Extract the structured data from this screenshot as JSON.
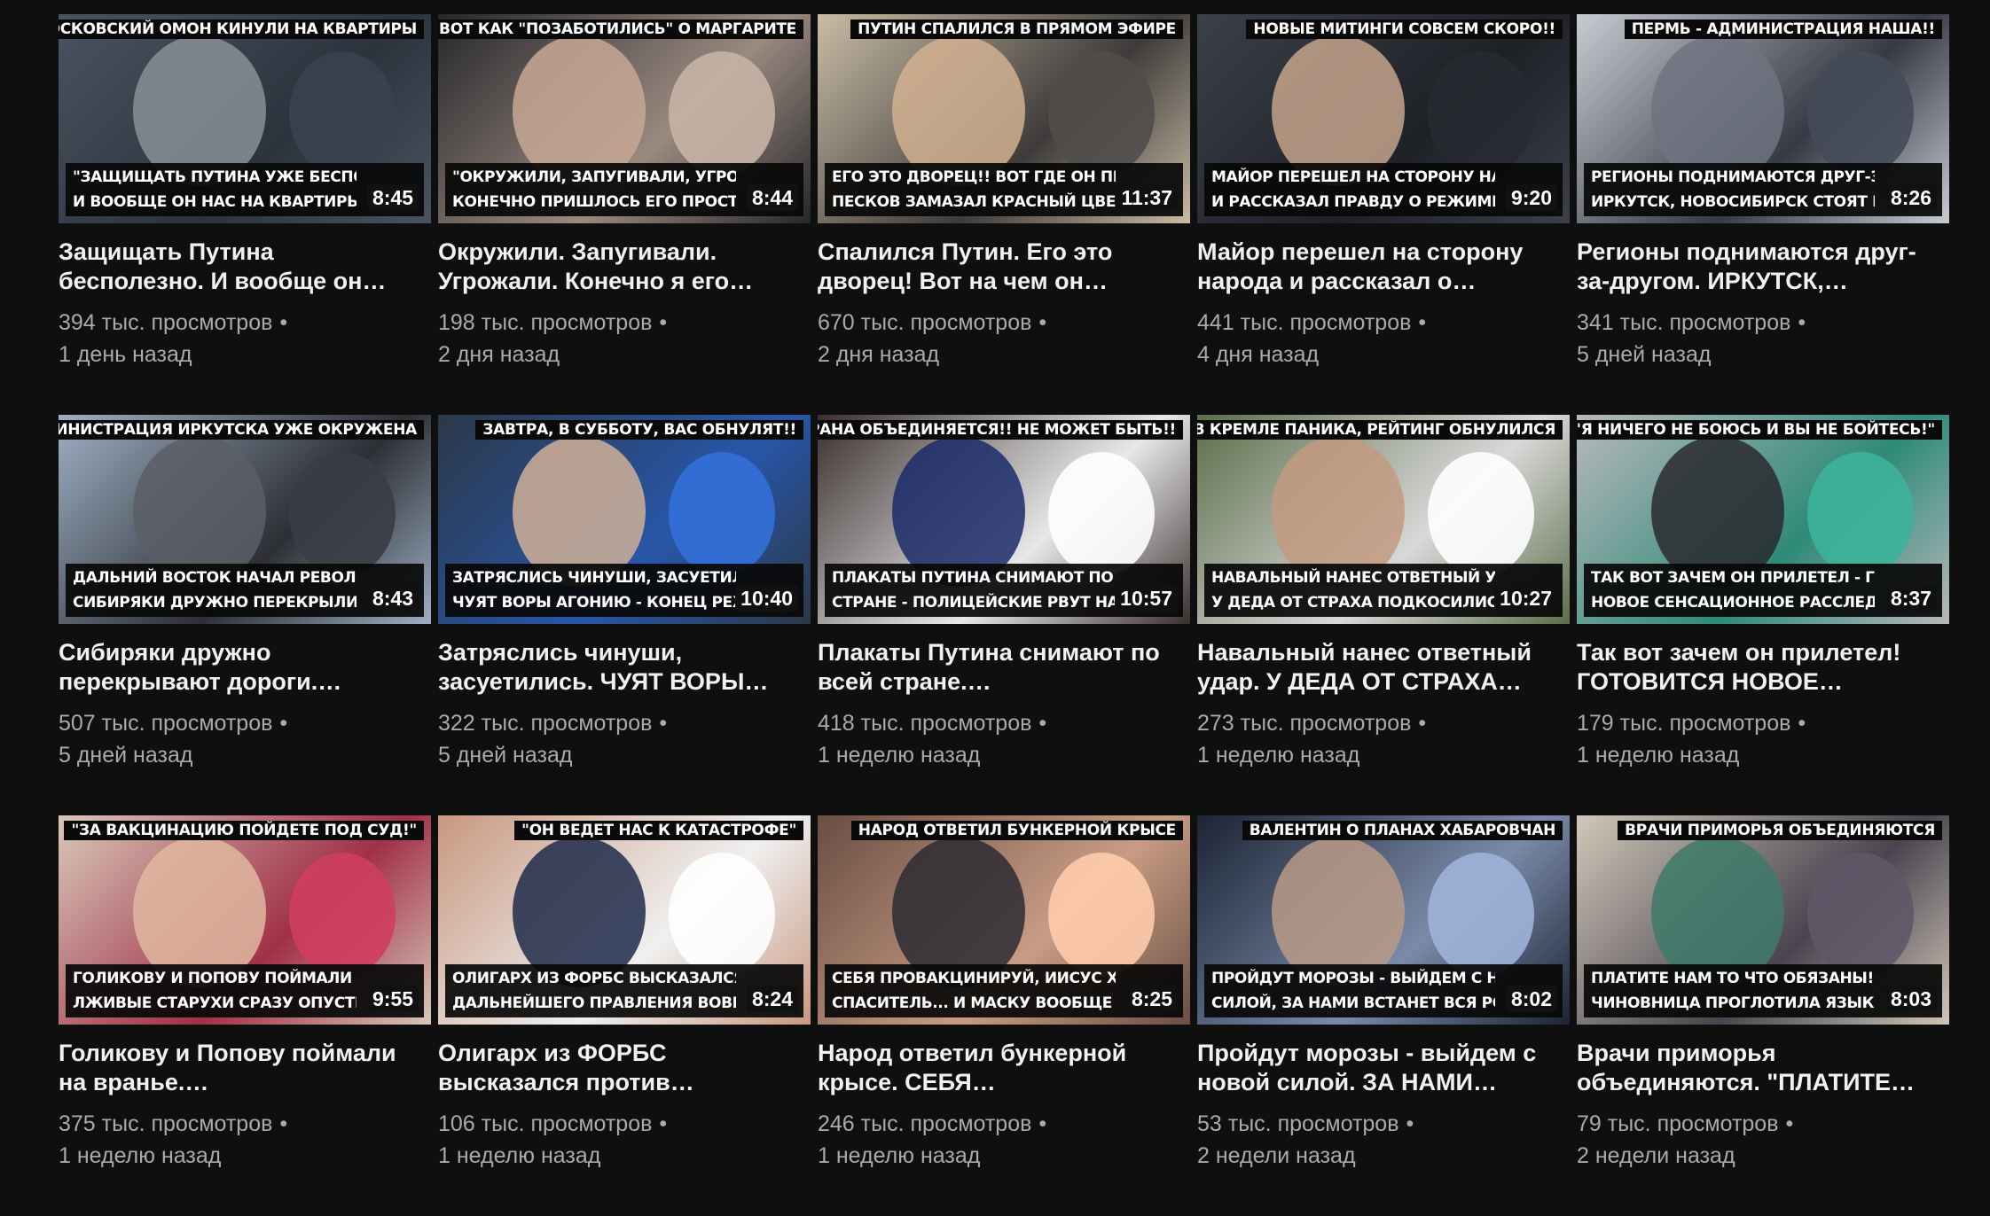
{
  "videos": [
    {
      "top_caption": "МОСКОВСКИЙ ОМОН КИНУЛИ НА КВАРТИРЫ",
      "caption_line1": "\"ЗАЩИЩАТЬ ПУТИНА УЖЕ БЕСПОЛЕЗНО",
      "caption_line2": "И ВООБЩЕ ОН НАС НА КВАРТИРЫ КИН",
      "duration": "8:45",
      "title": "Защищать Путина бесполезно. И вообще он…",
      "views": "394 тыс. просмотров",
      "age": "1 день назад",
      "colors": [
        "#4a5360",
        "#2c333d",
        "#8a8f96"
      ]
    },
    {
      "top_caption": "ВОТ КАК \"ПОЗАБОТИЛИСЬ\" О МАРГАРИТЕ",
      "caption_line1": "\"ОКРУЖИЛИ, ЗАПУГИВАЛИ, УГРОЖАЛИ,",
      "caption_line2": "КОНЕЧНО ПРИШЛОСЬ ЕГО ПРОСТИТЬ!",
      "duration": "8:44",
      "title": "Окружили. Запугивали. Угрожали. Конечно я его…",
      "views": "198 тыс. просмотров",
      "age": "2 дня назад",
      "colors": [
        "#26272a",
        "#9a8a80",
        "#c7a894"
      ]
    },
    {
      "top_caption": "ПУТИН СПАЛИЛСЯ В ПРЯМОМ ЭФИРЕ",
      "caption_line1": "ЕГО ЭТО ДВОРЕЦ!! ВОТ ГДЕ ОН ПРОКОЛОЛСЯ",
      "caption_line2": "ПЕСКОВ ЗАМАЗАЛ КРАСНЫЙ ЦВЕТ Л",
      "duration": "11:37",
      "title": "Спалился Путин. Его это дворец! Вот на чем он…",
      "views": "670 тыс. просмотров",
      "age": "2 дня назад",
      "colors": [
        "#c9bca5",
        "#3e3b3a",
        "#d2b090"
      ]
    },
    {
      "top_caption": "НОВЫЕ МИТИНГИ СОВСЕМ СКОРО!!",
      "caption_line1": "МАЙОР ПЕРЕШЕЛ НА СТОРОНУ НАРОДА",
      "caption_line2": "И РАССКАЗАЛ ПРАВДУ О РЕЖИМЕ ПУТ",
      "duration": "9:20",
      "title": "Майор перешел на сторону народа и рассказал о…",
      "views": "441 тыс. просмотров",
      "age": "4 дня назад",
      "colors": [
        "#3b4049",
        "#1e2126",
        "#c4a48c"
      ]
    },
    {
      "top_caption": "ПЕРМЬ - АДМИНИСТРАЦИЯ НАША!!",
      "caption_line1": "РЕГИОНЫ ПОДНИМАЮТСЯ ДРУГ-ЗА-ДРУГОМ",
      "caption_line2": "ИРКУТСК, НОВОСИБИРСК СТОЯТ В СЦ",
      "duration": "8:26",
      "title": "Регионы поднимаются друг-за-другом. ИРКУТСК,…",
      "views": "341 тыс. просмотров",
      "age": "5 дней назад",
      "colors": [
        "#c8ccd2",
        "#353a44",
        "#6f7480"
      ]
    },
    {
      "top_caption": "АДМИНИСТРАЦИЯ ИРКУТСКА УЖЕ ОКРУЖЕНА",
      "caption_line1": "ДАЛЬНИЙ ВОСТОК НАЧАЛ РЕВОЛЮЦИЮ!!",
      "caption_line2": "СИБИРЯКИ ДРУЖНО ПЕРЕКРЫЛИ ДОР",
      "duration": "8:43",
      "title": "Сибиряки дружно перекрывают дороги.…",
      "views": "507 тыс. просмотров",
      "age": "5 дней назад",
      "colors": [
        "#9eb0c4",
        "#2d2f35",
        "#5b5e66"
      ]
    },
    {
      "top_caption": "ЗАВТРА, В СУББОТУ, ВАС ОБНУЛЯТ!!",
      "caption_line1": "ЗАТРЯСЛИСЬ ЧИНУШИ, ЗАСУЕТИЛИСЬ",
      "caption_line2": "ЧУЯТ ВОРЫ АГОНИЮ - КОНЕЦ РЕЖИ",
      "duration": "10:40",
      "title": "Затряслись чинуши, засуетились. ЧУЯТ ВОРЫ…",
      "views": "322 тыс. просмотров",
      "age": "5 дней назад",
      "colors": [
        "#2c3848",
        "#2856a8",
        "#d0b098"
      ]
    },
    {
      "top_caption": "СТРАНА ОБЪЕДИНЯЕТСЯ!! НЕ МОЖЕТ БЫТЬ!!",
      "caption_line1": "ПЛАКАТЫ ПУТИНА СНИМАЮТ ПО ВСЕЙ",
      "caption_line2": "СТРАНЕ - ПОЛИЦЕЙСКИЕ РВУТ НАШИ",
      "duration": "10:57",
      "title": "Плакаты Путина снимают по всей стране.…",
      "views": "418 тыс. просмотров",
      "age": "1 неделю назад",
      "colors": [
        "#39302e",
        "#e8e8e8",
        "#1b2c6a"
      ]
    },
    {
      "top_caption": "В КРЕМЛЕ ПАНИКА, РЕЙТИНГ ОБНУЛИЛСЯ",
      "caption_line1": "НАВАЛЬНЫЙ НАНЕС ОТВЕТНЫЙ УДАР",
      "caption_line2": "У ДЕДА ОТ СТРАХА ПОДКОСИЛИСЬ Н",
      "duration": "10:27",
      "title": "Навальный нанес ответный удар. У ДЕДА ОТ СТРАХА…",
      "views": "273 тыс. просмотров",
      "age": "1 неделю назад",
      "colors": [
        "#5c6e4a",
        "#d8d8d8",
        "#c29a80"
      ]
    },
    {
      "top_caption": "\"Я НИЧЕГО НЕ БОЮСЬ И ВЫ НЕ БОЙТЕСЬ!\"",
      "caption_line1": "ТАК ВОТ ЗАЧЕМ ОН ПРИЛЕТЕЛ - ГОТОВИТСЯ",
      "caption_line2": "НОВОЕ СЕНСАЦИОННОЕ РАССЛЕДОВА",
      "duration": "8:37",
      "title": "Так вот зачем он прилетел! ГОТОВИТСЯ НОВОЕ…",
      "views": "179 тыс. просмотров",
      "age": "1 неделю назад",
      "colors": [
        "#b8b8bc",
        "#2f8a78",
        "#2a2a30"
      ]
    },
    {
      "top_caption": "\"ЗА ВАКЦИНАЦИЮ ПОЙДЕТЕ ПОД СУД!\"",
      "caption_line1": "ГОЛИКОВУ И ПОПОВУ ПОЙМАЛИ НА ВРАНЬЕ",
      "caption_line2": "ЛЖИВЫЕ СТАРУХИ СРАЗУ ОПУСТИЛИ",
      "duration": "9:55",
      "title": "Голикову и Попову поймали на вранье.…",
      "views": "375 тыс. просмотров",
      "age": "1 неделю назад",
      "colors": [
        "#d8c8b8",
        "#a03048",
        "#e0b8a0"
      ]
    },
    {
      "top_caption": "\"ОН ВЕДЕТ НАС К КАТАСТРОФЕ\"",
      "caption_line1": "ОЛИГАРХ ИЗ ФОРБС ВЫСКАЗАЛСЯ ПРОТИВ",
      "caption_line2": "ДАЛЬНЕЙШЕГО ПРАВЛЕНИЯ ВОВЫ ПУ",
      "duration": "8:24",
      "title": "Олигарх из ФОРБС высказался против…",
      "views": "106 тыс. просмотров",
      "age": "1 неделю назад",
      "colors": [
        "#c89880",
        "#f0f0f0",
        "#1e2a4a"
      ]
    },
    {
      "top_caption": "НАРОД ОТВЕТИЛ БУНКЕРНОЙ КРЫСЕ",
      "caption_line1": "СЕБЯ ПРОВАКЦИНИРУЙ, ИИСУС ХРЕНОВ",
      "caption_line2": "СПАСИТЕЛЬ... И МАСКУ ВООБЩЕ НАДІ",
      "duration": "8:25",
      "title": "Народ ответил бункерной крысе. СЕБЯ…",
      "views": "246 тыс. просмотров",
      "age": "1 неделю назад",
      "colors": [
        "#6a4e44",
        "#c89c84",
        "#2c2c34"
      ]
    },
    {
      "top_caption": "ВАЛЕНТИН О ПЛАНАХ ХАБАРОВЧАН",
      "caption_line1": "ПРОЙДУТ МОРОЗЫ - ВЫЙДЕМ С НОВОЙ",
      "caption_line2": "СИЛОЙ, ЗА НАМИ ВСТАНЕТ ВСЯ РОССИ",
      "duration": "8:02",
      "title": "Пройдут морозы - выйдем с новой силой. ЗА НАМИ…",
      "views": "53 тыс. просмотров",
      "age": "2 недели назад",
      "colors": [
        "#1c2434",
        "#7a8aa8",
        "#b89a86"
      ]
    },
    {
      "top_caption": "ВРАЧИ ПРИМОРЬЯ ОБЪЕДИНЯЮТСЯ",
      "caption_line1": "ПЛАТИТЕ НАМ ТО ЧТО ОБЯЗАНЫ!",
      "caption_line2": "ЧИНОВНИЦА ПРОГЛОТИЛА ЯЗЫК",
      "duration": "8:03",
      "title": "Врачи приморья объединяются. \"ПЛАТИТЕ…",
      "views": "79 тыс. просмотров",
      "age": "2 недели назад",
      "colors": [
        "#d0c8b8",
        "#4a4450",
        "#3e7a6a"
      ]
    }
  ]
}
